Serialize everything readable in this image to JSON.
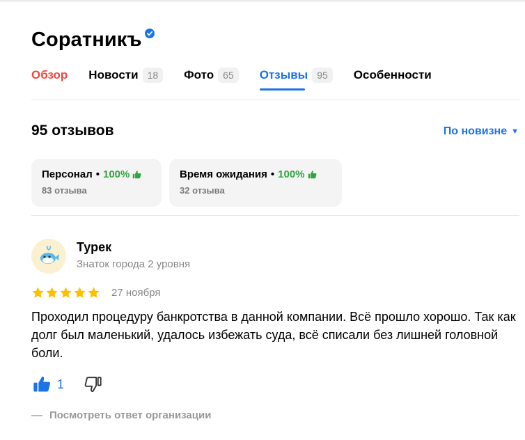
{
  "header": {
    "title": "Соратникъ"
  },
  "tabs": [
    {
      "label": "Обзор",
      "count": ""
    },
    {
      "label": "Новости",
      "count": "18"
    },
    {
      "label": "Фото",
      "count": "65"
    },
    {
      "label": "Отзывы",
      "count": "95"
    },
    {
      "label": "Особенности",
      "count": ""
    }
  ],
  "reviews": {
    "heading": "95 отзывов",
    "sort_label": "По новизне",
    "aspects": [
      {
        "name": "Персонал",
        "percent": "100%",
        "count": "83 отзыва"
      },
      {
        "name": "Время ожидания",
        "percent": "100%",
        "count": "32 отзыва"
      }
    ]
  },
  "review": {
    "author": "Турек",
    "level": "Знаток города 2 уровня",
    "rating": 5,
    "date": "27 ноября",
    "text": "Проходил процедуру банкротства в данной компании. Всё прошло хорошо. Так как долг был маленький, удалось избежать суда, всё списали без лишней головной боли.",
    "likes": "1",
    "org_answer_link": "Посмотреть ответ организации"
  },
  "colors": {
    "accent_blue": "#1a73e8",
    "active_red": "#f2473e",
    "positive_green": "#2fa53f",
    "star_yellow": "#fcc200"
  },
  "icons": {
    "verified": "verified-check-icon",
    "thumb_up": "thumb-up-icon",
    "thumb_down": "thumb-down-icon",
    "star": "star-icon",
    "avatar": "whale-avatar-icon"
  }
}
